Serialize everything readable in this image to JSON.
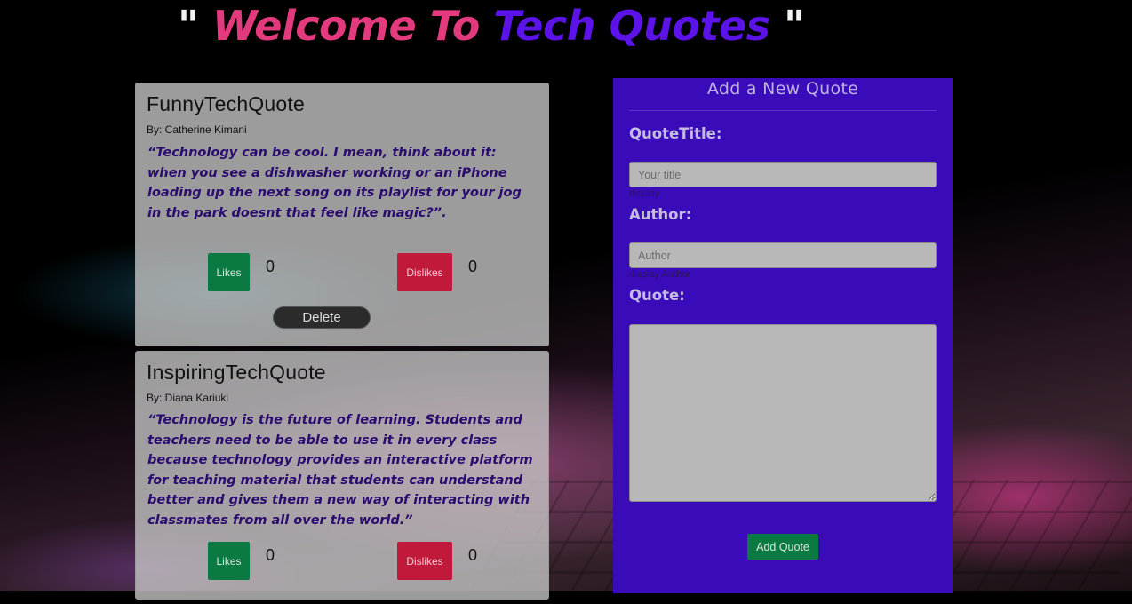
{
  "header": {
    "quote_open": "\"",
    "welcome": "Welcome To",
    "brand": "Tech Quotes",
    "quote_close": "\""
  },
  "quotes": [
    {
      "title": "FunnyTechQuote",
      "author": "By: Catherine Kimani",
      "text": "“Technology can be cool. I mean, think about it: when you see a dishwasher working or an iPhone loading up the next song on its playlist for your jog in the park doesnt that feel like magic?”.",
      "likes_label": "Likes",
      "likes": "0",
      "dislikes_label": "Dislikes",
      "dislikes": "0",
      "delete_label": "Delete"
    },
    {
      "title": "InspiringTechQuote",
      "author": "By: Diana Kariuki",
      "text": "“Technology is the future of learning. Students and teachers need to be able to use it in every class because technology provides an interactive platform for teaching material that students can understand better and gives them a new way of interacting with classmates from all over the world.”",
      "likes_label": "Likes",
      "likes": "0",
      "dislikes_label": "Dislikes",
      "dislikes": "0"
    }
  ],
  "form": {
    "heading": "Add a New Quote",
    "title_label": "QuoteTitle:",
    "title_placeholder": "Your title",
    "title_display": "display",
    "author_label": "Author:",
    "author_placeholder": "Author",
    "author_display": "display Author",
    "quote_label": "Quote:",
    "quote_value": "",
    "submit_label": "Add Quote"
  },
  "colors": {
    "welcome": "#e23a7d",
    "brand": "#5b13e8",
    "form_bg": "#3a0bb8",
    "likes_button": "#0b7a42",
    "dislikes_button": "#c0193a"
  }
}
